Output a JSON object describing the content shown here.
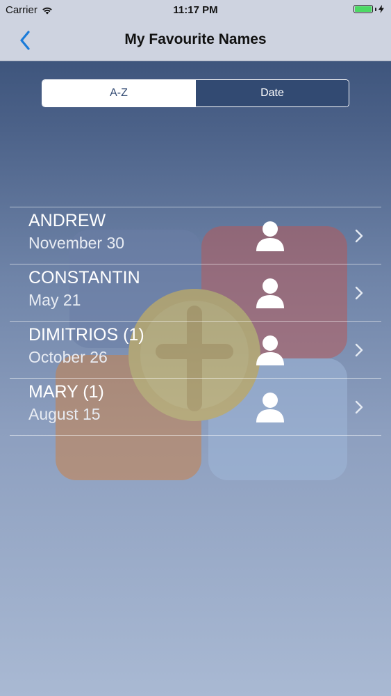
{
  "status_bar": {
    "carrier": "Carrier",
    "time": "11:17 PM",
    "battery_color": "#4cd964"
  },
  "nav": {
    "title": "My Favourite Names",
    "back_icon": "chevron-left-icon",
    "tint": "#1a7bd9"
  },
  "segment": {
    "options": [
      "A-Z",
      "Date"
    ],
    "selected": "A-Z"
  },
  "list": {
    "items": [
      {
        "name": "ANDREW",
        "date": "November 30",
        "icon": "person-icon"
      },
      {
        "name": "CONSTANTIN",
        "date": "May 21",
        "icon": "person-icon"
      },
      {
        "name": "DIMITRIOS (1)",
        "date": "October 26",
        "icon": "person-icon"
      },
      {
        "name": "MARY (1)",
        "date": "August 15",
        "icon": "person-icon"
      }
    ]
  }
}
